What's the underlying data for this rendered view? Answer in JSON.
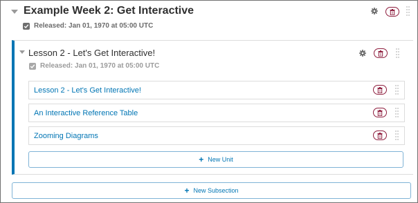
{
  "section": {
    "title": "Example Week 2: Get Interactive",
    "release": "Released: Jan 01, 1970 at 05:00 UTC"
  },
  "subsection": {
    "title": "Lesson 2 - Let's Get Interactive!",
    "release": "Released: Jan 01, 1970 at 05:00 UTC",
    "units": [
      {
        "label": "Lesson 2 - Let's Get Interactive!"
      },
      {
        "label": "An Interactive Reference Table"
      },
      {
        "label": "Zooming Diagrams"
      }
    ],
    "new_unit_label": "New Unit"
  },
  "new_subsection_label": "New Subsection",
  "icons": {
    "expand": "caret-down-icon",
    "settings": "gear-icon",
    "delete": "trash-icon",
    "drag": "drag-handle-icon",
    "released": "checkbox-checked-icon",
    "add": "plus-icon"
  },
  "colors": {
    "accent": "#0075b4",
    "delete": "#8d1c3c",
    "border": "#dcdcdc"
  }
}
